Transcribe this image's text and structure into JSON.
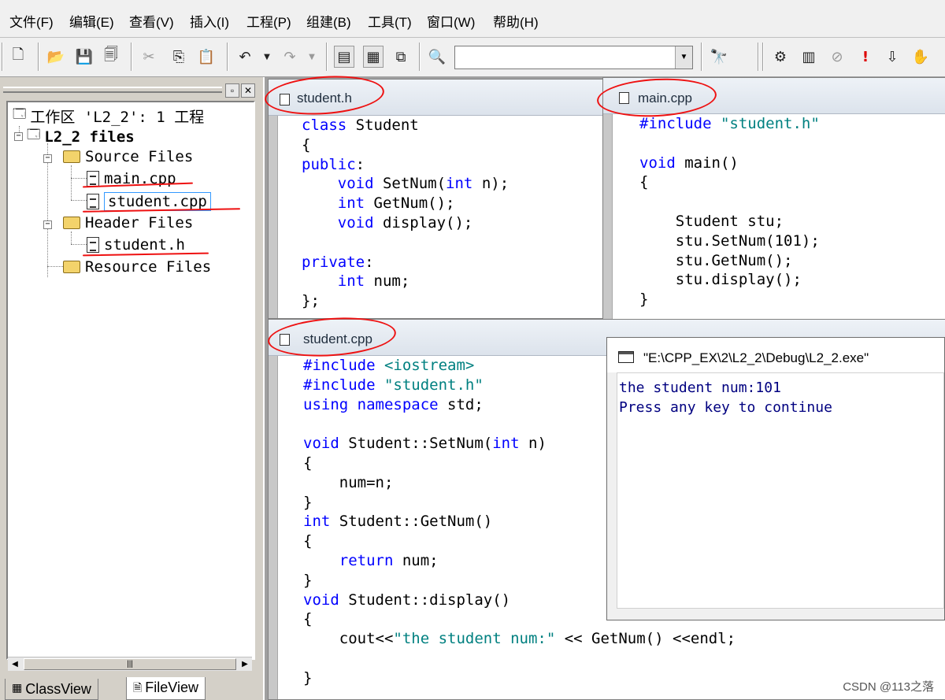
{
  "menubar": {
    "items": [
      "文件(F)",
      "编辑(E)",
      "查看(V)",
      "插入(I)",
      "工程(P)",
      "组建(B)",
      "工具(T)",
      "窗口(W)",
      "帮助(H)"
    ]
  },
  "workspace": {
    "root": "工作区 'L2_2': 1 工程",
    "project": "L2_2 files",
    "source_folder": "Source Files",
    "source_files": [
      "main.cpp",
      "student.cpp"
    ],
    "header_folder": "Header Files",
    "header_files": [
      "student.h"
    ],
    "resource_folder": "Resource Files",
    "tabs": [
      "ClassView",
      "FileView"
    ],
    "active_tab": "FileView",
    "selected_file": "student.cpp"
  },
  "editors": {
    "student_h": {
      "title": "student.h",
      "lines": [
        [
          [
            "kw",
            "class"
          ],
          [
            "t",
            " Student"
          ]
        ],
        [
          [
            "t",
            "{"
          ]
        ],
        [
          [
            "kw",
            "public"
          ],
          [
            "t",
            ":"
          ]
        ],
        [
          [
            "t",
            "    "
          ],
          [
            "kw",
            "void"
          ],
          [
            "t",
            " SetNum("
          ],
          [
            "kw",
            "int"
          ],
          [
            "t",
            " n);"
          ]
        ],
        [
          [
            "t",
            "    "
          ],
          [
            "kw",
            "int"
          ],
          [
            "t",
            " GetNum();"
          ]
        ],
        [
          [
            "t",
            "    "
          ],
          [
            "kw",
            "void"
          ],
          [
            "t",
            " display();"
          ]
        ],
        [
          [
            "t",
            ""
          ]
        ],
        [
          [
            "kw",
            "private"
          ],
          [
            "t",
            ":"
          ]
        ],
        [
          [
            "t",
            "    "
          ],
          [
            "kw",
            "int"
          ],
          [
            "t",
            " num;"
          ]
        ],
        [
          [
            "t",
            "};"
          ]
        ]
      ]
    },
    "main_cpp": {
      "title": "main.cpp",
      "lines": [
        [
          [
            "pp",
            "#include"
          ],
          [
            "t",
            " "
          ],
          [
            "str",
            "\"student.h\""
          ]
        ],
        [
          [
            "t",
            ""
          ]
        ],
        [
          [
            "kw",
            "void"
          ],
          [
            "t",
            " main()"
          ]
        ],
        [
          [
            "t",
            "{"
          ]
        ],
        [
          [
            "t",
            ""
          ]
        ],
        [
          [
            "t",
            "    Student stu;"
          ]
        ],
        [
          [
            "t",
            "    stu.SetNum(101);"
          ]
        ],
        [
          [
            "t",
            "    stu.GetNum();"
          ]
        ],
        [
          [
            "t",
            "    stu.display();"
          ]
        ],
        [
          [
            "t",
            "}"
          ]
        ]
      ]
    },
    "student_cpp": {
      "title": "student.cpp",
      "lines": [
        [
          [
            "pp",
            "#include"
          ],
          [
            "t",
            " "
          ],
          [
            "str",
            "<iostream>"
          ]
        ],
        [
          [
            "pp",
            "#include"
          ],
          [
            "t",
            " "
          ],
          [
            "str",
            "\"student.h\""
          ]
        ],
        [
          [
            "kw",
            "using"
          ],
          [
            "t",
            " "
          ],
          [
            "kw",
            "namespace"
          ],
          [
            "t",
            " std;"
          ]
        ],
        [
          [
            "t",
            ""
          ]
        ],
        [
          [
            "kw",
            "void"
          ],
          [
            "t",
            " Student::SetNum("
          ],
          [
            "kw",
            "int"
          ],
          [
            "t",
            " n)"
          ]
        ],
        [
          [
            "t",
            "{"
          ]
        ],
        [
          [
            "t",
            "    num=n;"
          ]
        ],
        [
          [
            "t",
            "}"
          ]
        ],
        [
          [
            "kw",
            "int"
          ],
          [
            "t",
            " Student::GetNum()"
          ]
        ],
        [
          [
            "t",
            "{"
          ]
        ],
        [
          [
            "t",
            "    "
          ],
          [
            "kw",
            "return"
          ],
          [
            "t",
            " num;"
          ]
        ],
        [
          [
            "t",
            "}"
          ]
        ],
        [
          [
            "kw",
            "void"
          ],
          [
            "t",
            " Student::display()"
          ]
        ],
        [
          [
            "t",
            "{"
          ]
        ],
        [
          [
            "t",
            "    cout<<"
          ],
          [
            "str",
            "\"the student num:\""
          ],
          [
            "t",
            " << GetNum() <<endl;"
          ]
        ],
        [
          [
            "t",
            ""
          ]
        ],
        [
          [
            "t",
            "}"
          ]
        ]
      ]
    }
  },
  "console": {
    "title": "\"E:\\CPP_EX\\2\\L2_2\\Debug\\L2_2.exe\"",
    "output": "the student num:101\nPress any key to continue"
  },
  "watermark": "CSDN @113之落",
  "colors": {
    "keyword": "#0000ff",
    "string": "#008080",
    "annotation": "#ee1111"
  }
}
